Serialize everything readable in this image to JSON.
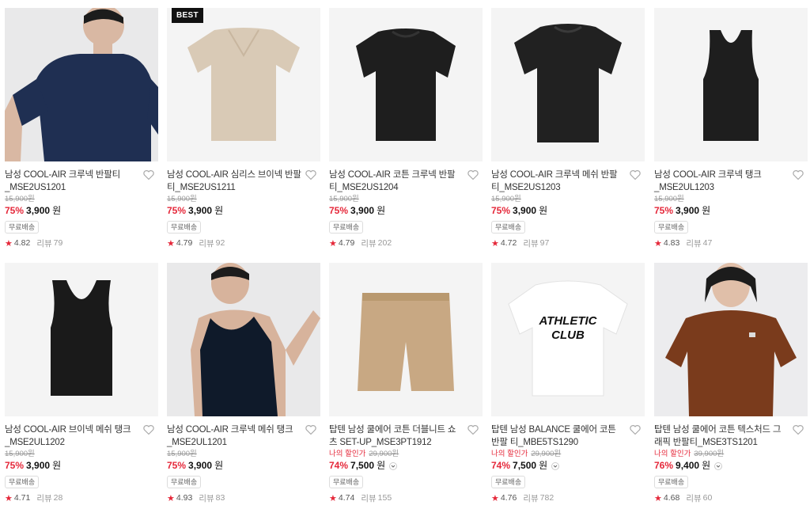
{
  "products": [
    {
      "title": "남성 COOL-AIR 크루넥 반팔티 _MSE2US1201",
      "original_price": "15,900원",
      "my_discount_label": "",
      "discount_rate": "75%",
      "price": "3,900",
      "currency": "원",
      "has_dropdown": false,
      "shipping": "무료배송",
      "rating": "4.82",
      "review_label": "리뷰",
      "review_count": "79",
      "badge": "",
      "image": "model-navy-tshirt"
    },
    {
      "title": "남성 COOL-AIR 심리스 브이넥 반팔 티_MSE2US1211",
      "original_price": "15,900원",
      "my_discount_label": "",
      "discount_rate": "75%",
      "price": "3,900",
      "currency": "원",
      "has_dropdown": false,
      "shipping": "무료배송",
      "rating": "4.79",
      "review_label": "리뷰",
      "review_count": "92",
      "badge": "BEST",
      "image": "beige-vneck-tshirt"
    },
    {
      "title": "남성 COOL-AIR 코튼 크루넥 반팔 티_MSE2US1204",
      "original_price": "15,900원",
      "my_discount_label": "",
      "discount_rate": "75%",
      "price": "3,900",
      "currency": "원",
      "has_dropdown": false,
      "shipping": "무료배송",
      "rating": "4.79",
      "review_label": "리뷰",
      "review_count": "202",
      "badge": "",
      "image": "black-crew-tshirt"
    },
    {
      "title": "남성 COOL-AIR 크루넥 메쉬 반팔 티_MSE2US1203",
      "original_price": "15,900원",
      "my_discount_label": "",
      "discount_rate": "75%",
      "price": "3,900",
      "currency": "원",
      "has_dropdown": false,
      "shipping": "무료배송",
      "rating": "4.72",
      "review_label": "리뷰",
      "review_count": "97",
      "badge": "",
      "image": "black-mesh-tshirt"
    },
    {
      "title": "남성 COOL-AIR 크루넥 탱크 _MSE2UL1203",
      "original_price": "15,900원",
      "my_discount_label": "",
      "discount_rate": "75%",
      "price": "3,900",
      "currency": "원",
      "has_dropdown": false,
      "shipping": "무료배송",
      "rating": "4.83",
      "review_label": "리뷰",
      "review_count": "47",
      "badge": "",
      "image": "black-tank"
    },
    {
      "title": "남성 COOL-AIR 브이넥 메쉬 탱크 _MSE2UL1202",
      "original_price": "15,900원",
      "my_discount_label": "",
      "discount_rate": "75%",
      "price": "3,900",
      "currency": "원",
      "has_dropdown": false,
      "shipping": "무료배송",
      "rating": "4.71",
      "review_label": "리뷰",
      "review_count": "28",
      "badge": "",
      "image": "black-vneck-tank"
    },
    {
      "title": "남성 COOL-AIR 크루넥 메쉬 탱크 _MSE2UL1201",
      "original_price": "15,900원",
      "my_discount_label": "",
      "discount_rate": "75%",
      "price": "3,900",
      "currency": "원",
      "has_dropdown": false,
      "shipping": "무료배송",
      "rating": "4.93",
      "review_label": "리뷰",
      "review_count": "83",
      "badge": "",
      "image": "model-black-tank"
    },
    {
      "title": "탑텐 남성 쿨에어 코튼 더블니트 쇼츠 SET-UP_MSE3PT1912",
      "original_price": "29,900원",
      "my_discount_label": "나의 할인가",
      "discount_rate": "74%",
      "price": "7,500",
      "currency": "원",
      "has_dropdown": true,
      "shipping": "무료배송",
      "rating": "4.74",
      "review_label": "리뷰",
      "review_count": "155",
      "badge": "",
      "image": "beige-shorts"
    },
    {
      "title": "탑텐 남성 BALANCE 쿨에어 코튼 반팔 티_MBE5TS1290",
      "original_price": "29,900원",
      "my_discount_label": "나의 할인가",
      "discount_rate": "74%",
      "price": "7,500",
      "currency": "원",
      "has_dropdown": true,
      "shipping": "무료배송",
      "rating": "4.76",
      "review_label": "리뷰",
      "review_count": "782",
      "badge": "",
      "image": "white-graphic-tshirt",
      "graphic_text_1": "ATHLETIC",
      "graphic_text_2": "CLUB"
    },
    {
      "title": "탑텐 남성 쿨에어 코튼 텍스처드 그래픽 반팔티_MSE3TS1201",
      "original_price": "39,900원",
      "my_discount_label": "나의 할인가",
      "discount_rate": "76%",
      "price": "9,400",
      "currency": "원",
      "has_dropdown": true,
      "shipping": "무료배송",
      "rating": "4.68",
      "review_label": "리뷰",
      "review_count": "60",
      "badge": "",
      "image": "model-brown-tshirt"
    }
  ],
  "colors": {
    "accent": "#e5283a",
    "text": "#222222",
    "muted": "#999999",
    "thumb_bg": "#f4f4f4"
  }
}
